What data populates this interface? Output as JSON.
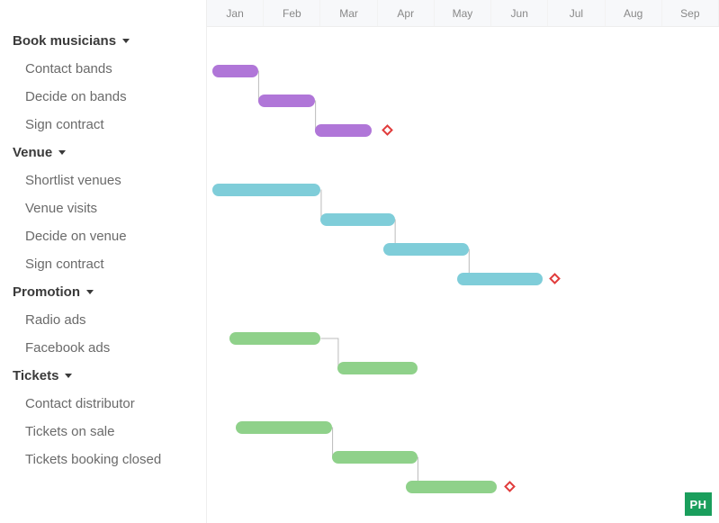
{
  "chart_data": {
    "type": "gantt",
    "months": [
      "Jan",
      "Feb",
      "Mar",
      "Apr",
      "May",
      "Jun",
      "Jul",
      "Aug",
      "Sep"
    ],
    "groups": [
      {
        "name": "Book musicians",
        "color": "purple",
        "tasks": [
          {
            "name": "Contact bands",
            "start": 0.1,
            "end": 0.9
          },
          {
            "name": "Decide on bands",
            "start": 0.9,
            "end": 1.9
          },
          {
            "name": "Sign contract",
            "start": 1.9,
            "end": 2.9,
            "milestone_after": 3.1
          }
        ]
      },
      {
        "name": "Venue",
        "color": "blue",
        "tasks": [
          {
            "name": "Shortlist venues",
            "start": 0.1,
            "end": 2.0
          },
          {
            "name": "Venue visits",
            "start": 2.0,
            "end": 3.3
          },
          {
            "name": "Decide on venue",
            "start": 3.1,
            "end": 4.6
          },
          {
            "name": "Sign contract",
            "start": 4.4,
            "end": 5.9,
            "milestone_after": 6.05
          }
        ]
      },
      {
        "name": "Promotion",
        "color": "green",
        "tasks": [
          {
            "name": "Radio ads",
            "start": 0.4,
            "end": 2.0
          },
          {
            "name": "Facebook ads",
            "start": 2.3,
            "end": 3.7
          }
        ]
      },
      {
        "name": "Tickets",
        "color": "green",
        "tasks": [
          {
            "name": "Contact distributor",
            "start": 0.5,
            "end": 2.2
          },
          {
            "name": "Tickets on sale",
            "start": 2.2,
            "end": 3.7
          },
          {
            "name": "Tickets booking closed",
            "start": 3.5,
            "end": 5.1,
            "milestone_after": 5.25
          }
        ]
      }
    ]
  },
  "badge": {
    "label": "PH"
  }
}
